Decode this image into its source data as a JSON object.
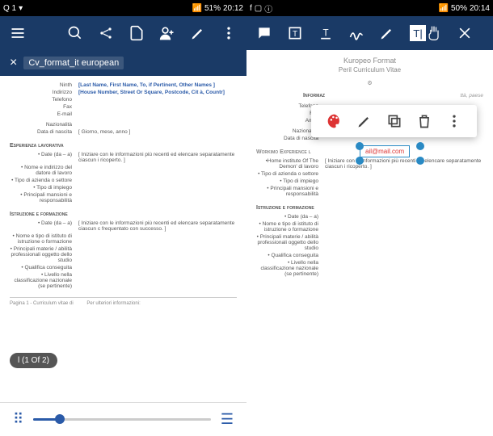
{
  "left": {
    "status": {
      "net": "Q 1",
      "battery": "51%",
      "time": "20:12"
    },
    "tab": "Cv_format_it european",
    "sections": {
      "personal_head": "Ninth",
      "nameStr": "[Last Name, First Name, To, if Pertinent, Other Names ]",
      "addrStr": "[House Number, Street Or Square, Postcode, Cit à, Countr]",
      "labs": {
        "indirizzo": "Indirizzo",
        "telefono": "Telefono",
        "fax": "Fax",
        "email": "E-mail",
        "naz": "Nazionalità",
        "nascita": "Data di nascita"
      },
      "nascitaVal": "[ Giorno, mese, anno ]",
      "exp_head": "Esperienza lavorativa",
      "dateLab": "• Date (da – a)",
      "expDesc": "[ Iniziare con le informazioni più recenti ed elencare separatamente ciascun i ricoperto. ]",
      "emp": "• Nome e indirizzo del datore di lavoro",
      "tipo": "• Tipo di azienda o settore",
      "impiego": "• Tipo di impiego",
      "mans": "• Principali mansioni e responsabilità",
      "edu_head": "Istruzione e formazione",
      "eduDesc": "[ Iniziare con le informazioni più recenti ed elencare separatamente ciascun c frequentato con successo. ]",
      "ist": "• Nome e tipo di istituto di istruzione o formazione",
      "mat": "• Principali materie / abilità professionali oggetto dello studio",
      "qual": "• Qualifica conseguita",
      "liv": "• Livello nella classificazione nazionale (se pertinente)"
    },
    "pageInd": "l (1 Of 2)",
    "footer": {
      "pg": "Pagina 1 - Curriculum vitae di",
      "ult": "Per ulteriori informazioni:"
    }
  },
  "right": {
    "status": {
      "battery": "50%",
      "time": "20:14"
    },
    "title": "Kuropeo Format",
    "sub": "Peril Curriculum Vitae",
    "sel": "ail@mail.com",
    "info_head": "Informaz",
    "maskTxt": "ttà, paese",
    "labs": {
      "telefono": "Telefono",
      "fax": "Fax",
      "amail": "Amail",
      "naz": "Nazionalità",
      "nascita": "Data di nascita"
    },
    "work_head": "Workimo Experience l",
    "homeInst": "•Home institute Of The Demon' di lavoro",
    "expDesc": "[ Iniziare con le informazioni più recenti ed elencare separatamente ciascun i ricoperto. ]",
    "tipo": "• Tipo di azienda o settore",
    "impiego": "• Tipo di impiego",
    "mans": "• Principali mansioni e responsabilità",
    "edu_head": "Istruzione e formazione",
    "dateLab": "• Date (da – a)",
    "ist": "• Nome e tipo di istituto di istruzione o formazione",
    "mat": "• Principali materie / abilità professionali oggetto dello studio",
    "qual": "• Qualifica conseguita",
    "liv": "• Livello nella classificazione nazionale (se pertinente)"
  }
}
